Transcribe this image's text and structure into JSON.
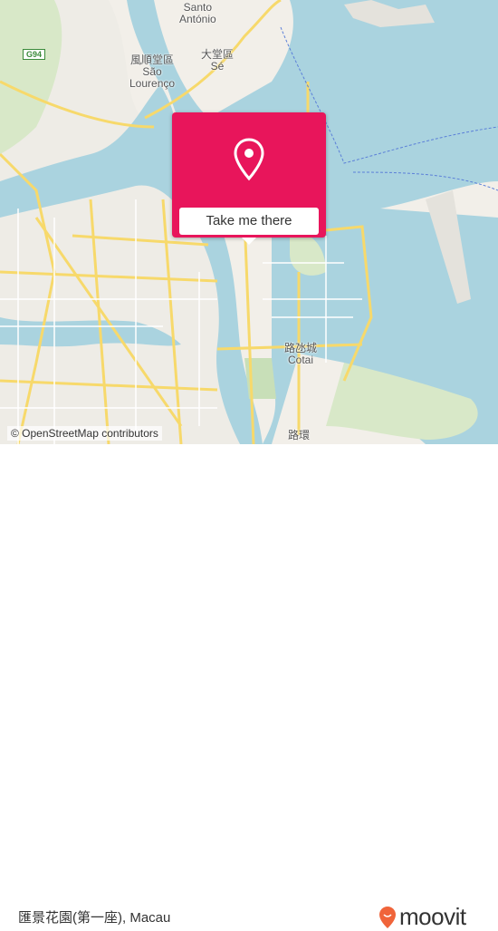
{
  "map": {
    "labels": {
      "santo_antonio": "Santo\nAntónio",
      "sao_lourenco": "風順堂區\nSão\nLourenço",
      "se": "大堂區\nSé",
      "cotai": "路氹城\nCotai",
      "coloane": "路環",
      "g94": "G94"
    },
    "colors": {
      "water": "#aad3df",
      "land": "#f2efe9",
      "green": "#d8e8c8",
      "road": "#f7d96b"
    }
  },
  "popup": {
    "button_label": "Take me there",
    "color": "#e8155b",
    "icon": "location-pin-icon"
  },
  "attribution": "© OpenStreetMap contributors",
  "footer": {
    "place": "匯景花園(第一座), Macau",
    "brand": "moovit",
    "brand_color": "#f0643a"
  }
}
